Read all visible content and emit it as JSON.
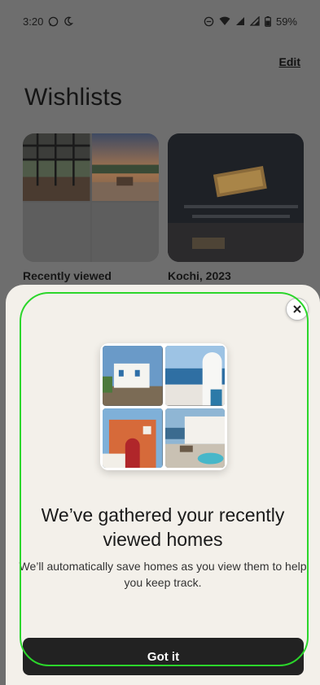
{
  "status_bar": {
    "time": "3:20",
    "battery": "59%"
  },
  "header": {
    "edit_label": "Edit",
    "title": "Wishlists"
  },
  "wishlists": [
    {
      "label": "Recently viewed"
    },
    {
      "label": "Kochi, 2023"
    }
  ],
  "sheet": {
    "title": "We’ve gathered your recently viewed homes",
    "description": "We’ll automatically save homes as you view them to help you keep track.",
    "button_label": "Got it"
  },
  "colors": {
    "overlay": "#6e6e6e",
    "sheet_bg": "#f3f0ea",
    "button_bg": "#222222",
    "highlight": "#2bd62b"
  }
}
